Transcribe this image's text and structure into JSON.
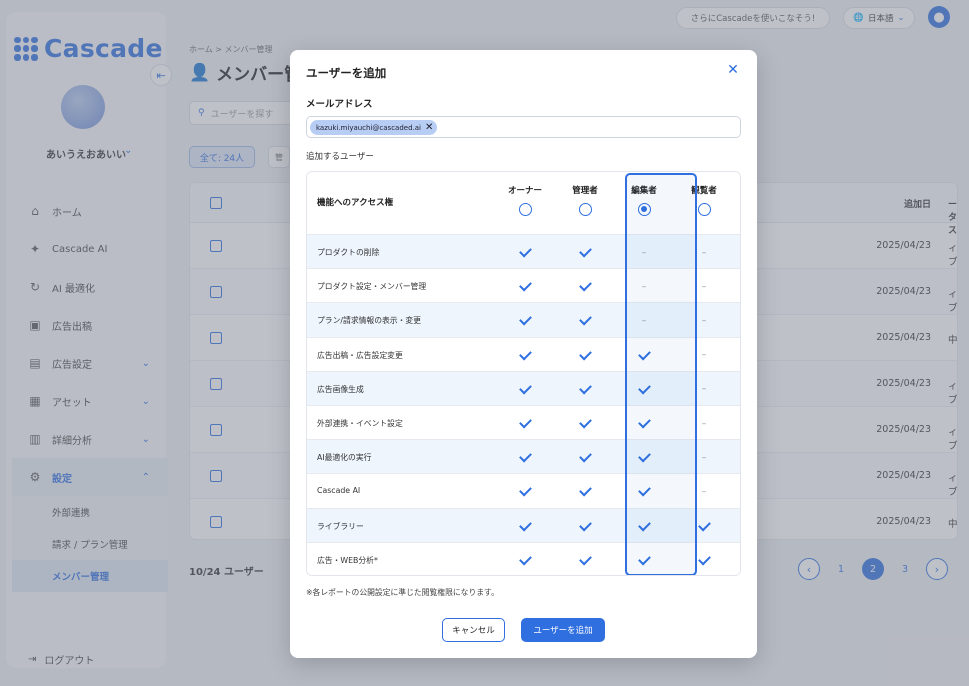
{
  "app": {
    "logo_text": "Cascade",
    "topbar_pill": "さらにCascadeを使いこなそう!",
    "language": "日本語"
  },
  "sidebar": {
    "org_name": "あいうえおあいい",
    "items": [
      {
        "label": "ホーム",
        "icon": "home-icon"
      },
      {
        "label": "Cascade AI",
        "icon": "sparkle-icon"
      },
      {
        "label": "AI 最適化",
        "icon": "refresh-icon"
      },
      {
        "label": "広告出稿",
        "icon": "ad-icon"
      },
      {
        "label": "広告設定",
        "icon": "ad-settings-icon"
      },
      {
        "label": "アセット",
        "icon": "image-icon"
      },
      {
        "label": "詳細分析",
        "icon": "chart-icon"
      },
      {
        "label": "設定",
        "icon": "gear-icon"
      }
    ],
    "sub_items": [
      "外部連携",
      "請求 / プラン管理",
      "メンバー管理"
    ],
    "logout": "ログアウト"
  },
  "background": {
    "breadcrumb": "ホーム > メンバー管理",
    "page_title": "メンバー管",
    "search_placeholder": "ユーザーを探す",
    "filter_all": "全て: 24人",
    "filter_other": "管",
    "col_status": "ータス",
    "col_date": "追加日",
    "rows": [
      {
        "status": "ィブ",
        "date": "2025/04/23"
      },
      {
        "status": "ィブ",
        "date": "2025/04/23"
      },
      {
        "status": "中",
        "date": "2025/04/23"
      },
      {
        "status": "ィブ",
        "date": "2025/04/23"
      },
      {
        "status": "ィブ",
        "date": "2025/04/23"
      },
      {
        "status": "ィブ",
        "date": "2025/04/23"
      },
      {
        "status": "中",
        "date": "2025/04/23"
      }
    ],
    "count": "10/24 ユーザー",
    "pages": [
      "1",
      "2",
      "3"
    ],
    "current_page": "2"
  },
  "modal": {
    "title": "ユーザーを追加",
    "email_label": "メールアドレス",
    "email_chip": "kazuki.miyauchi@cascaded.ai",
    "users_label": "追加するユーザー",
    "feature_header": "機能へのアクセス権",
    "roles": [
      "オーナー",
      "管理者",
      "編集者",
      "観覧者"
    ],
    "selected_role": "編集者",
    "rows": [
      {
        "feature": "プロダクトの削除",
        "perms": [
          "check",
          "check",
          "dash",
          "dash"
        ]
      },
      {
        "feature": "プロダクト設定・メンバー管理",
        "perms": [
          "check",
          "check",
          "dash",
          "dash"
        ]
      },
      {
        "feature": "プラン/請求情報の表示・変更",
        "perms": [
          "check",
          "check",
          "dash",
          "dash"
        ]
      },
      {
        "feature": "広告出稿・広告設定変更",
        "perms": [
          "check",
          "check",
          "check",
          "dash"
        ]
      },
      {
        "feature": "広告画像生成",
        "perms": [
          "check",
          "check",
          "check",
          "dash"
        ]
      },
      {
        "feature": "外部連携・イベント設定",
        "perms": [
          "check",
          "check",
          "check",
          "dash"
        ]
      },
      {
        "feature": "AI最適化の実行",
        "perms": [
          "check",
          "check",
          "check",
          "dash"
        ]
      },
      {
        "feature": "Cascade AI",
        "perms": [
          "check",
          "check",
          "check",
          "dash"
        ]
      },
      {
        "feature": "ライブラリー",
        "perms": [
          "check",
          "check",
          "check",
          "check"
        ]
      },
      {
        "feature": "広告・WEB分析*",
        "perms": [
          "check",
          "check",
          "check",
          "check"
        ]
      }
    ],
    "footnote": "※各レポートの公開設定に準じた閲覧権限になります。",
    "cancel_label": "キャンセル",
    "submit_label": "ユーザーを追加"
  },
  "colors": {
    "accent": "#2f6fe0",
    "row_tint": "#eef5fd"
  }
}
